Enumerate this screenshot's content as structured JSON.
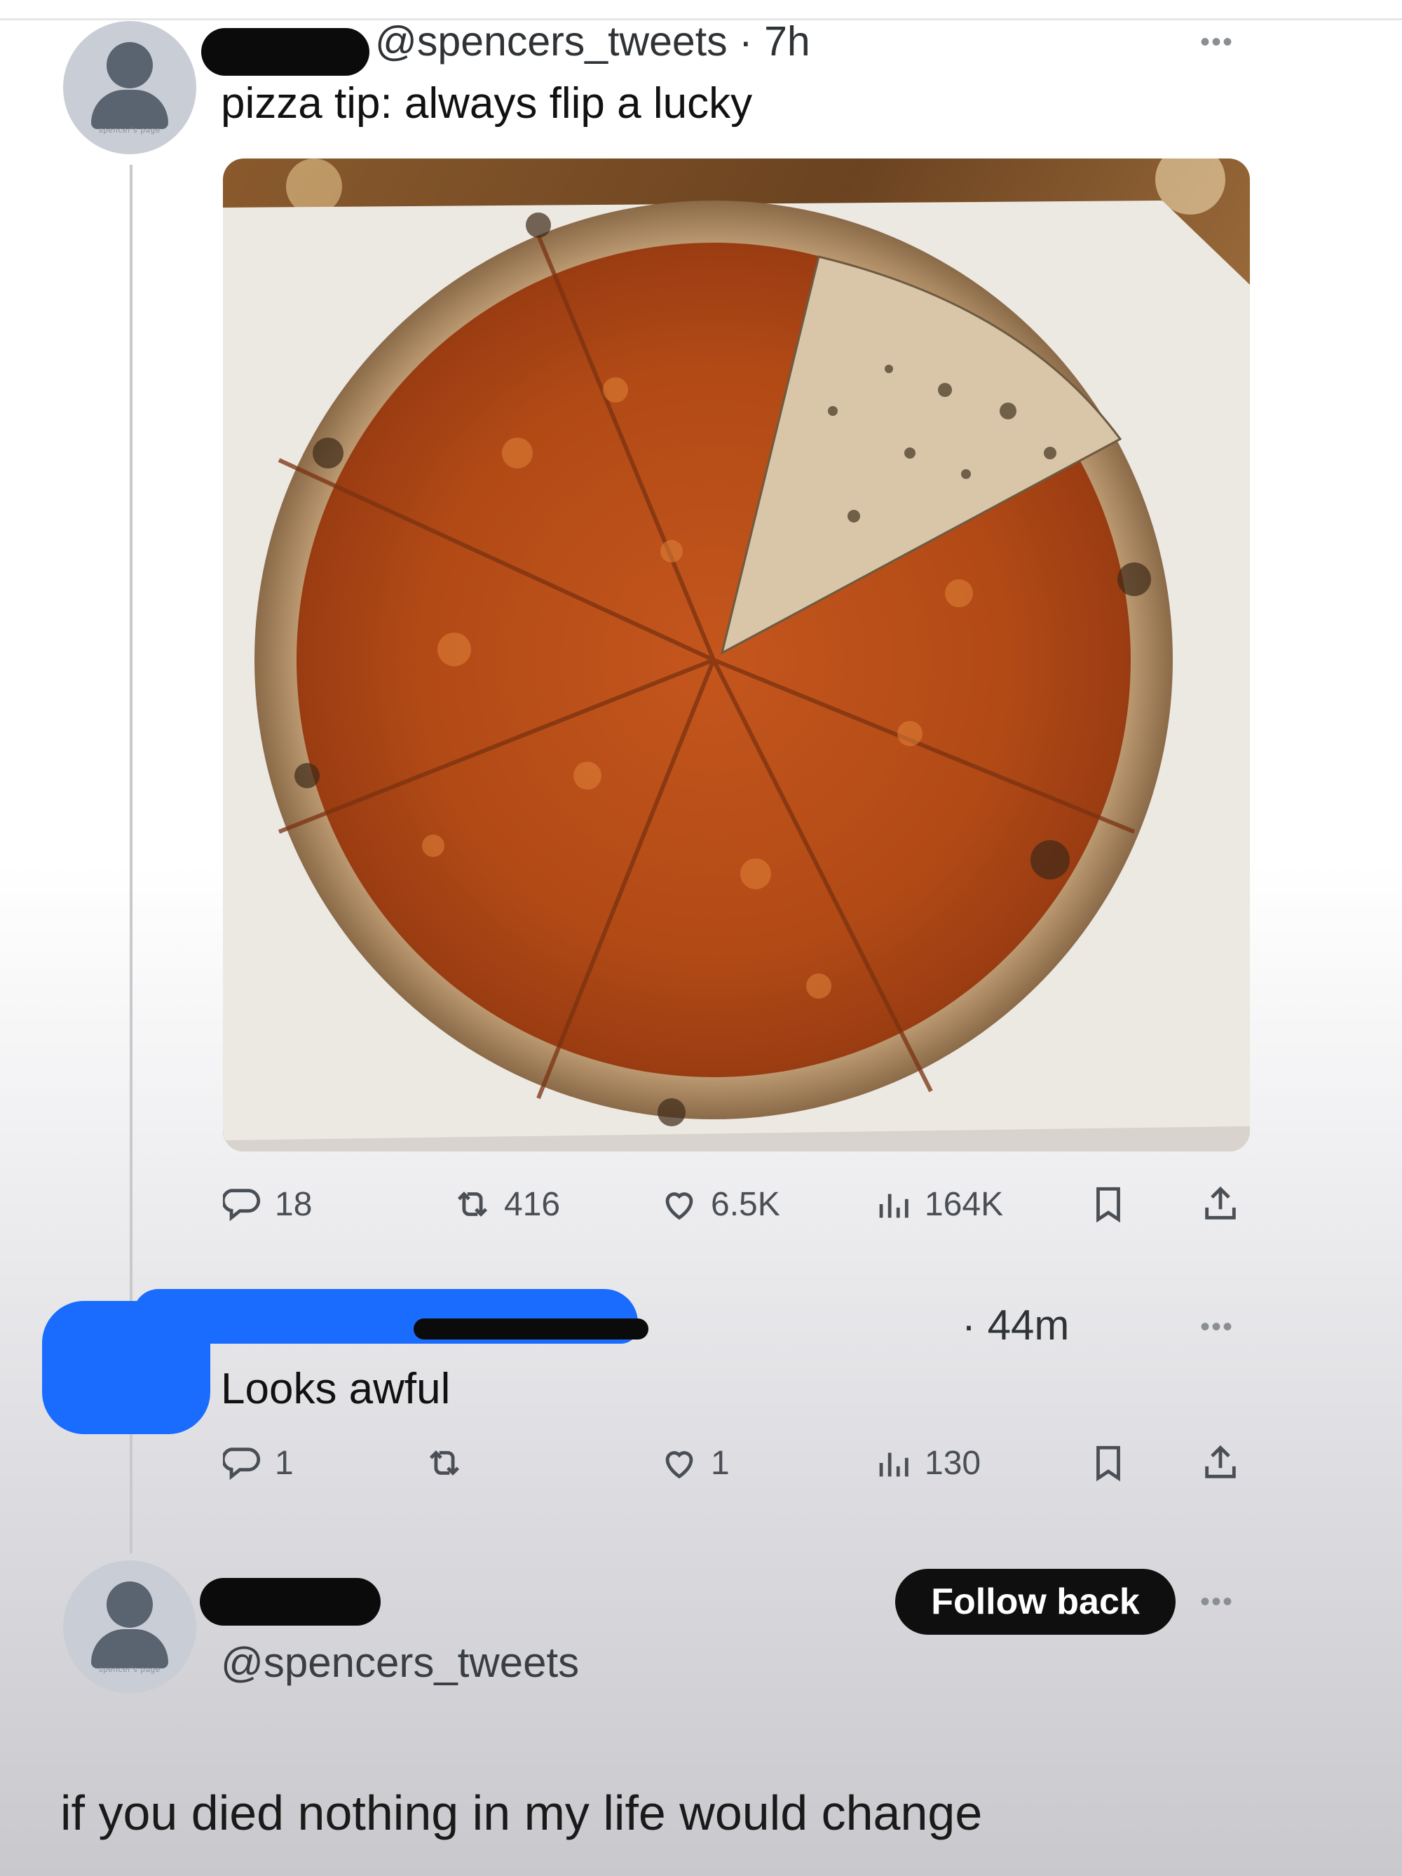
{
  "thread": {
    "post": {
      "handle": "@spencers_tweets",
      "time": "· 7h",
      "text": "pizza tip: always flip a lucky",
      "avatar_caption": "spencer's page",
      "image_alt": "pizza",
      "stats": {
        "replies": "18",
        "reposts": "416",
        "likes": "6.5K",
        "views": "164K"
      }
    },
    "reply": {
      "time": "· 44m",
      "text": "Looks awful",
      "stats": {
        "replies": "1",
        "reposts": "",
        "likes": "1",
        "views": "130"
      }
    },
    "quote": {
      "handle": "@spencers_tweets",
      "follow_label": "Follow back",
      "avatar_caption": "spencer's page",
      "text": "if you died nothing in my life would change"
    }
  },
  "icons": {
    "reply": "reply-icon",
    "repost": "repost-icon",
    "like": "heart-icon",
    "views": "views-icon",
    "bookmark": "bookmark-icon",
    "share": "share-icon",
    "more": "more-icon"
  },
  "colors": {
    "redaction_black": "#0b0b0b",
    "redaction_blue": "#1a6cff",
    "follow_button": "#0f0f10"
  }
}
